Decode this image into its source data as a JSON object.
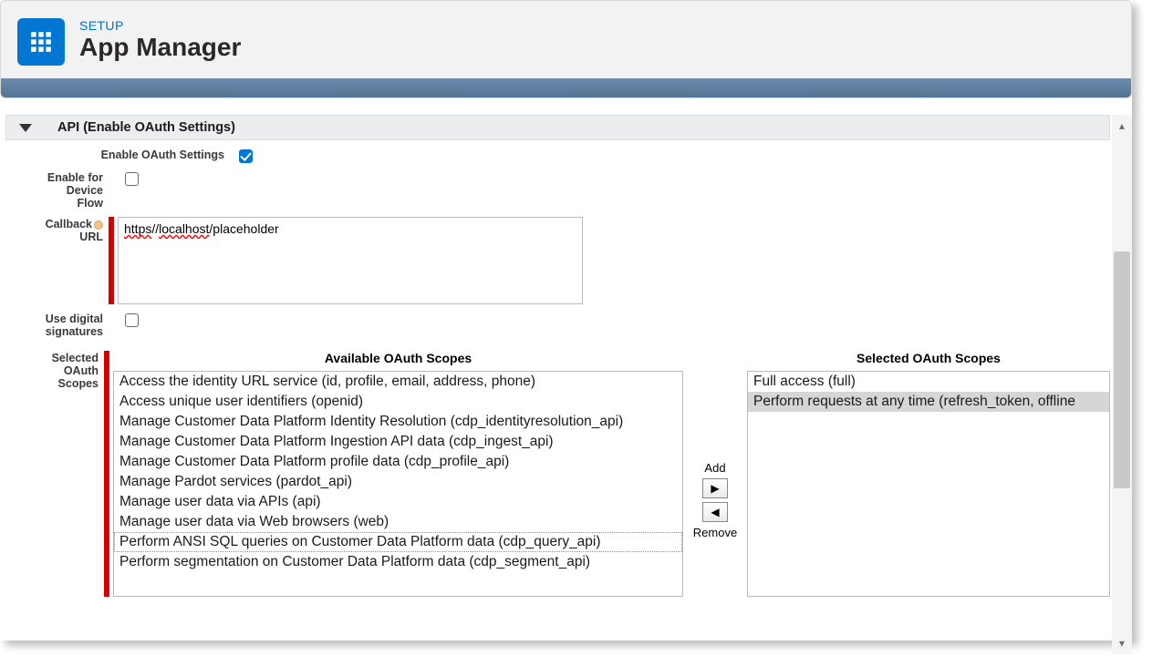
{
  "header": {
    "crumb": "SETUP",
    "title": "App Manager"
  },
  "section": {
    "title": "API (Enable OAuth Settings)"
  },
  "form": {
    "enable_oauth_label": "Enable OAuth Settings",
    "enable_oauth_checked": true,
    "enable_device_label_l1": "Enable for",
    "enable_device_label_l2": "Device",
    "enable_device_label_l3": "Flow",
    "enable_device_checked": false,
    "callback_label_l1": "Callback",
    "callback_label_l2": "URL",
    "callback_value_display_prefix": "https",
    "callback_value_display_mid1": "//",
    "callback_value_display_u1": "localhost",
    "callback_value_display_mid2": "/placeholder",
    "callback_value_raw": "https//localhost/placeholder",
    "use_sig_label_l1": "Use digital",
    "use_sig_label_l2": "signatures",
    "use_sig_checked": false,
    "scopes_label_l1": "Selected",
    "scopes_label_l2": "OAuth",
    "scopes_label_l3": "Scopes"
  },
  "scopes": {
    "available_title": "Available OAuth Scopes",
    "selected_title": "Selected OAuth Scopes",
    "add_label": "Add",
    "remove_label": "Remove",
    "available": [
      "Access the identity URL service (id, profile, email, address, phone)",
      "Access unique user identifiers (openid)",
      "Manage Customer Data Platform Identity Resolution (cdp_identityresolution_api)",
      "Manage Customer Data Platform Ingestion API data (cdp_ingest_api)",
      "Manage Customer Data Platform profile data (cdp_profile_api)",
      "Manage Pardot services (pardot_api)",
      "Manage user data via APIs (api)",
      "Manage user data via Web browsers (web)",
      "Perform ANSI SQL queries on Customer Data Platform data (cdp_query_api)",
      "Perform segmentation on Customer Data Platform data (cdp_segment_api)"
    ],
    "available_highlight_index": 8,
    "selected": [
      "Full access (full)",
      "Perform requests at any time (refresh_token, offline"
    ],
    "selected_highlight_index": 1
  }
}
